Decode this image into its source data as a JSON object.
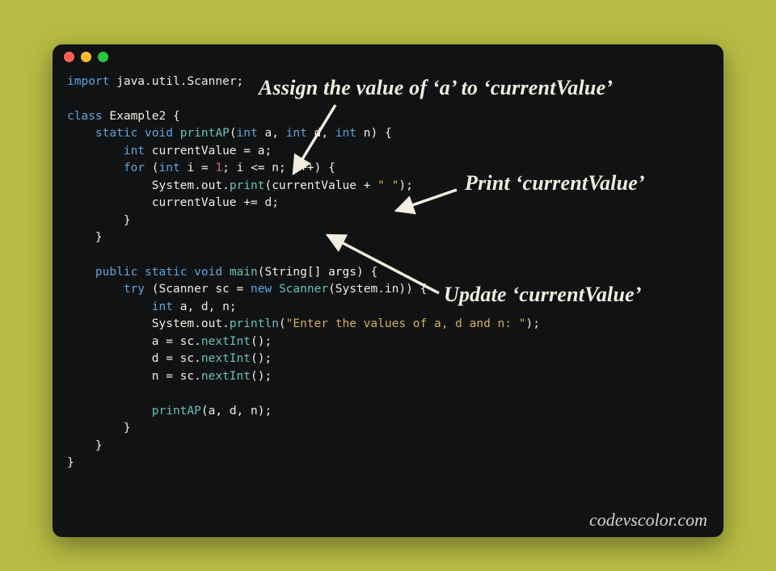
{
  "annotations": {
    "a1": "Assign the value of ‘a’ to ‘currentValue’",
    "a2": "Print ‘currentValue’",
    "a3": "Update ‘currentValue’"
  },
  "watermark": "codevscolor.com",
  "code": {
    "tokens": [
      [
        [
          "kw",
          "import"
        ],
        [
          "id",
          " java"
        ],
        [
          "punc",
          "."
        ],
        [
          "id",
          "util"
        ],
        [
          "punc",
          "."
        ],
        [
          "id",
          "Scanner"
        ],
        [
          "punc",
          ";"
        ]
      ],
      [],
      [
        [
          "kw",
          "class"
        ],
        [
          "id",
          " Example2 "
        ],
        [
          "punc",
          "{"
        ]
      ],
      [
        [
          "id",
          "    "
        ],
        [
          "kw",
          "static"
        ],
        [
          "id",
          " "
        ],
        [
          "kw",
          "void"
        ],
        [
          "id",
          " "
        ],
        [
          "fn",
          "printAP"
        ],
        [
          "punc",
          "("
        ],
        [
          "kw",
          "int"
        ],
        [
          "id",
          " a"
        ],
        [
          "punc",
          ", "
        ],
        [
          "kw",
          "int"
        ],
        [
          "id",
          " d"
        ],
        [
          "punc",
          ", "
        ],
        [
          "kw",
          "int"
        ],
        [
          "id",
          " n"
        ],
        [
          "punc",
          ") {"
        ]
      ],
      [
        [
          "id",
          "        "
        ],
        [
          "kw",
          "int"
        ],
        [
          "id",
          " currentValue "
        ],
        [
          "punc",
          "="
        ],
        [
          "id",
          " a"
        ],
        [
          "punc",
          ";"
        ]
      ],
      [
        [
          "id",
          "        "
        ],
        [
          "kw",
          "for"
        ],
        [
          "id",
          " "
        ],
        [
          "punc",
          "("
        ],
        [
          "kw",
          "int"
        ],
        [
          "id",
          " i "
        ],
        [
          "punc",
          "="
        ],
        [
          "id",
          " "
        ],
        [
          "num",
          "1"
        ],
        [
          "punc",
          "; "
        ],
        [
          "id",
          "i "
        ],
        [
          "punc",
          "<="
        ],
        [
          "id",
          " n"
        ],
        [
          "punc",
          "; "
        ],
        [
          "id",
          "i"
        ],
        [
          "punc",
          "++"
        ],
        [
          "punc",
          ") {"
        ]
      ],
      [
        [
          "id",
          "            System"
        ],
        [
          "punc",
          "."
        ],
        [
          "id",
          "out"
        ],
        [
          "punc",
          "."
        ],
        [
          "fn",
          "print"
        ],
        [
          "punc",
          "("
        ],
        [
          "id",
          "currentValue "
        ],
        [
          "punc",
          "+"
        ],
        [
          "id",
          " "
        ],
        [
          "str",
          "\" \""
        ],
        [
          "punc",
          ");"
        ]
      ],
      [
        [
          "id",
          "            currentValue "
        ],
        [
          "punc",
          "+="
        ],
        [
          "id",
          " d"
        ],
        [
          "punc",
          ";"
        ]
      ],
      [
        [
          "id",
          "        "
        ],
        [
          "punc",
          "}"
        ]
      ],
      [
        [
          "id",
          "    "
        ],
        [
          "punc",
          "}"
        ]
      ],
      [],
      [
        [
          "id",
          "    "
        ],
        [
          "kw",
          "public"
        ],
        [
          "id",
          " "
        ],
        [
          "kw",
          "static"
        ],
        [
          "id",
          " "
        ],
        [
          "kw",
          "void"
        ],
        [
          "id",
          " "
        ],
        [
          "fn",
          "main"
        ],
        [
          "punc",
          "("
        ],
        [
          "id",
          "String"
        ],
        [
          "punc",
          "[]"
        ],
        [
          "id",
          " args"
        ],
        [
          "punc",
          ") {"
        ]
      ],
      [
        [
          "id",
          "        "
        ],
        [
          "kw",
          "try"
        ],
        [
          "id",
          " "
        ],
        [
          "punc",
          "("
        ],
        [
          "id",
          "Scanner sc "
        ],
        [
          "punc",
          "="
        ],
        [
          "id",
          " "
        ],
        [
          "kw",
          "new"
        ],
        [
          "id",
          " "
        ],
        [
          "fn",
          "Scanner"
        ],
        [
          "punc",
          "("
        ],
        [
          "id",
          "System"
        ],
        [
          "punc",
          "."
        ],
        [
          "id",
          "in"
        ],
        [
          "punc",
          ")) {"
        ]
      ],
      [
        [
          "id",
          "            "
        ],
        [
          "kw",
          "int"
        ],
        [
          "id",
          " a"
        ],
        [
          "punc",
          ","
        ],
        [
          "id",
          " d"
        ],
        [
          "punc",
          ","
        ],
        [
          "id",
          " n"
        ],
        [
          "punc",
          ";"
        ]
      ],
      [
        [
          "id",
          "            System"
        ],
        [
          "punc",
          "."
        ],
        [
          "id",
          "out"
        ],
        [
          "punc",
          "."
        ],
        [
          "fn",
          "println"
        ],
        [
          "punc",
          "("
        ],
        [
          "str",
          "\"Enter the values of a, d and n: \""
        ],
        [
          "punc",
          ");"
        ]
      ],
      [
        [
          "id",
          "            a "
        ],
        [
          "punc",
          "="
        ],
        [
          "id",
          " sc"
        ],
        [
          "punc",
          "."
        ],
        [
          "fn",
          "nextInt"
        ],
        [
          "punc",
          "();"
        ]
      ],
      [
        [
          "id",
          "            d "
        ],
        [
          "punc",
          "="
        ],
        [
          "id",
          " sc"
        ],
        [
          "punc",
          "."
        ],
        [
          "fn",
          "nextInt"
        ],
        [
          "punc",
          "();"
        ]
      ],
      [
        [
          "id",
          "            n "
        ],
        [
          "punc",
          "="
        ],
        [
          "id",
          " sc"
        ],
        [
          "punc",
          "."
        ],
        [
          "fn",
          "nextInt"
        ],
        [
          "punc",
          "();"
        ]
      ],
      [],
      [
        [
          "id",
          "            "
        ],
        [
          "fn",
          "printAP"
        ],
        [
          "punc",
          "("
        ],
        [
          "id",
          "a"
        ],
        [
          "punc",
          ", "
        ],
        [
          "id",
          "d"
        ],
        [
          "punc",
          ", "
        ],
        [
          "id",
          "n"
        ],
        [
          "punc",
          ");"
        ]
      ],
      [
        [
          "id",
          "        "
        ],
        [
          "punc",
          "}"
        ]
      ],
      [
        [
          "id",
          "    "
        ],
        [
          "punc",
          "}"
        ]
      ],
      [
        [
          "punc",
          "}"
        ]
      ]
    ]
  }
}
